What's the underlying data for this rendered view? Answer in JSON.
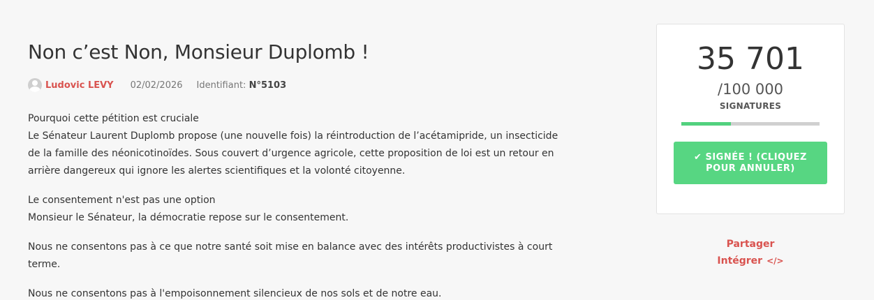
{
  "petition": {
    "title": "Non c’est Non, Monsieur Duplomb !",
    "author": "Ludovic LEVY",
    "date": "02/02/2026",
    "identifier_label": "Identifiant:",
    "identifier_value": "N°5103"
  },
  "content": {
    "p1_line1": "Pourquoi cette pétition est cruciale",
    "p1_line2": "Le Sénateur Laurent Duplomb propose (une nouvelle fois) la réintroduction de l’acétamipride, un insecticide de la famille des néonicotinoïdes. Sous couvert d’urgence agricole, cette proposition de loi est un retour en arrière dangereux qui ignore les alertes scientifiques et la volonté citoyenne.",
    "p2_line1": "Le consentement n'est pas une option",
    "p2_line2": "Monsieur le Sénateur, la démocratie repose sur le consentement.",
    "p3": "Nous ne consentons pas à ce que notre santé soit mise en balance avec des intérêts productivistes à court terme.",
    "p4": "Nous ne consentons pas à l'empoisonnement silencieux de nos sols et de notre eau."
  },
  "signatures": {
    "count": "35 701",
    "goal": "/100 000",
    "label": "SIGNATURES",
    "progress_percent": 35.7,
    "progress_color": "#52d17e"
  },
  "sign_button": {
    "line1": "✔ SIGNÉE ! (CLIQUEZ",
    "line2": "POUR ANNULER)",
    "color": "#57d682"
  },
  "actions": {
    "share": "Partager",
    "embed": "Intégrer",
    "embed_icon": "code-icon"
  },
  "colors": {
    "accent": "#d9534f"
  }
}
